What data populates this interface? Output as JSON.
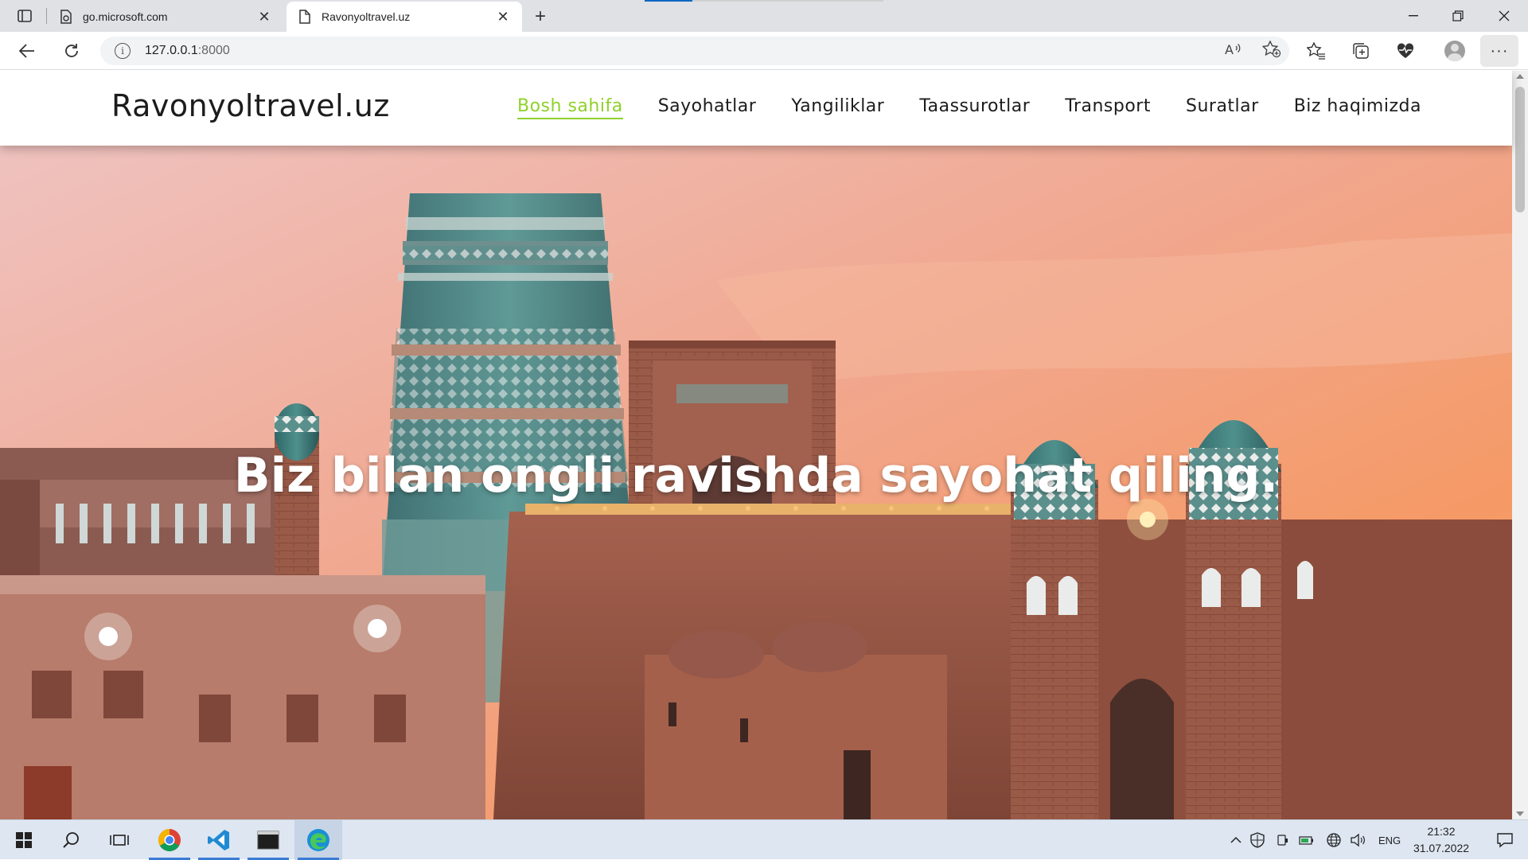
{
  "browser": {
    "tabs": [
      {
        "title": "go.microsoft.com",
        "active": false
      },
      {
        "title": "Ravonyoltravel.uz",
        "active": true
      }
    ],
    "address": {
      "host": "127.0.0.1",
      "port": ":8000"
    }
  },
  "site": {
    "logo": "Ravonyoltravel.uz",
    "menu": [
      {
        "label": "Bosh sahifa",
        "active": true
      },
      {
        "label": "Sayohatlar",
        "active": false
      },
      {
        "label": "Yangiliklar",
        "active": false
      },
      {
        "label": "Taassurotlar",
        "active": false
      },
      {
        "label": "Transport",
        "active": false
      },
      {
        "label": "Suratlar",
        "active": false
      },
      {
        "label": "Biz haqimizda",
        "active": false
      }
    ],
    "hero_title": "Biz bilan ongli ravishda sayohat qiling.",
    "accent_color": "#8fd12a"
  },
  "taskbar": {
    "language": "ENG",
    "time": "21:32",
    "date": "31.07.2022",
    "apps": [
      "chrome-icon",
      "vscode-icon",
      "terminal-icon",
      "edge-icon"
    ]
  }
}
